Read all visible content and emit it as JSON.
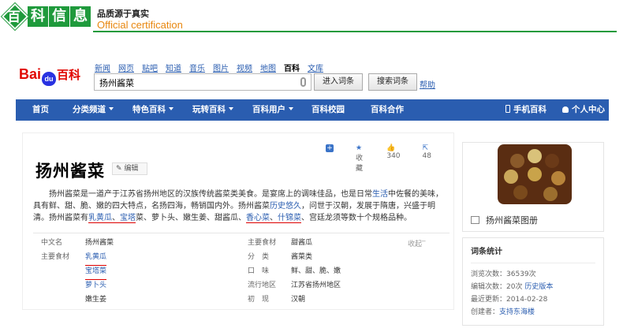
{
  "banner": {
    "tiles": [
      "百",
      "科",
      "信",
      "息"
    ],
    "line1": "品质源于真实",
    "line2": "Official certification"
  },
  "header": {
    "logo_bai": "Bai",
    "logo_paw": "du",
    "logo_baike": "百科",
    "nav_links": [
      "新闻",
      "网页",
      "贴吧",
      "知道",
      "音乐",
      "图片",
      "视频",
      "地图",
      "百科",
      "文库"
    ],
    "search_value": "扬州酱菜",
    "enter_button": "进入词条",
    "search_button": "搜索词条",
    "help": "帮助"
  },
  "navbar": {
    "home": "首页",
    "channels": "分类频道",
    "featured": "特色百科",
    "fun": "玩转百科",
    "users": "百科用户",
    "campus": "百科校园",
    "cooperation": "百科合作",
    "mobile": "手机百科",
    "user_center": "个人中心"
  },
  "entry": {
    "toolbar": {
      "favorite": "收藏",
      "likes": "340",
      "shares": "48"
    },
    "title": "扬州酱菜",
    "edit": "编辑",
    "summary": {
      "p1": "扬州酱菜是一道产于江苏省扬州地区的汉族传统酱菜类美食。是宴席上的调味佳品，也是日常",
      "l1": "生活",
      "p2": "中佐餐的美味，具有鲜、甜、脆、嫩的四大特点，名扬四海，畅销国内外。扬州酱菜",
      "l2": "历史悠久",
      "p3": "，问世于汉朝，发展于隋唐，兴盛于明清。扬州酱菜有",
      "l3": "乳黄瓜",
      "p4": "、",
      "l4": "宝塔",
      "p5": "菜、萝卜头、嫩生姜、甜酱瓜、",
      "l5": "香心菜",
      "p6": "、",
      "l6": "什锦菜",
      "p7": "、宫廷龙须等数十个规格品种。"
    },
    "collapse": "收起",
    "info_left": [
      {
        "label": "中文名",
        "value": "扬州酱菜"
      },
      {
        "label": "主要食材",
        "value": "乳黄瓜"
      },
      {
        "label": "",
        "value": "宝塔菜"
      },
      {
        "label": "",
        "value": "萝卜头"
      },
      {
        "label": "",
        "value": "嫩生姜"
      }
    ],
    "info_right": [
      {
        "label": "主要食材",
        "value": "甜酱瓜"
      },
      {
        "label": "分　类",
        "value": "酱菜类"
      },
      {
        "label": "口　味",
        "value": "鲜、甜、脆、嫩"
      },
      {
        "label": "流行地区",
        "value": "江苏省扬州地区"
      },
      {
        "label": "初　现",
        "value": "汉朝"
      }
    ]
  },
  "sidebar": {
    "album": "扬州酱菜图册",
    "stats_title": "词条统计",
    "views_label": "浏览次数：",
    "views": "36539次",
    "edits_label": "编辑次数：",
    "edits": "20次",
    "history": "历史版本",
    "updated_label": "最近更新：",
    "updated": "2014-02-28",
    "creator_label": "创建者：",
    "creator": "支持东海楼"
  },
  "colors": {
    "brand_green": "#1f9a3c",
    "nav_blue": "#2a5db0",
    "highlight_red": "#dd0000",
    "orange": "#e8870f"
  }
}
